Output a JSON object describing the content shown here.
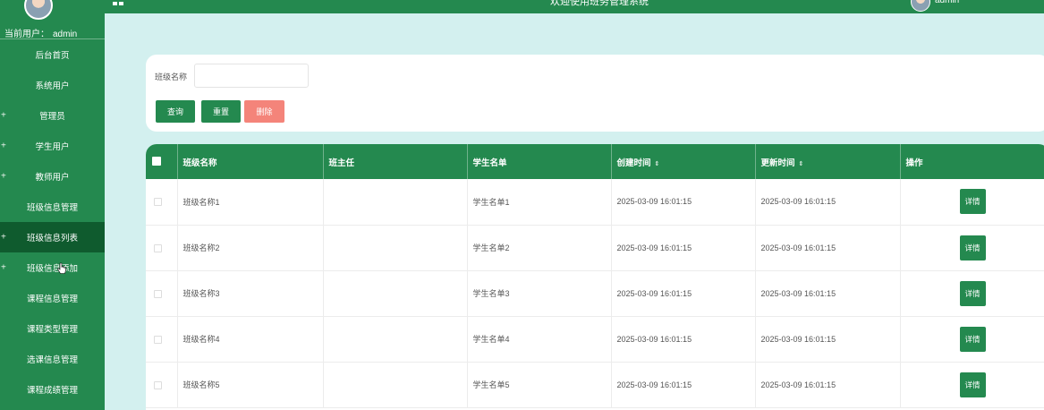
{
  "sidebar": {
    "current_user_label": "当前用户：",
    "current_user_name": "admin",
    "items": [
      {
        "label": "后台首页",
        "expandable": false
      },
      {
        "label": "系统用户",
        "expandable": false
      },
      {
        "label": "管理员",
        "expandable": true
      },
      {
        "label": "学生用户",
        "expandable": true
      },
      {
        "label": "教师用户",
        "expandable": true
      },
      {
        "label": "班级信息管理",
        "expandable": false
      },
      {
        "label": "班级信息列表",
        "expandable": true,
        "active": true
      },
      {
        "label": "班级信息添加",
        "expandable": true
      },
      {
        "label": "课程信息管理",
        "expandable": false
      },
      {
        "label": "课程类型管理",
        "expandable": false
      },
      {
        "label": "选课信息管理",
        "expandable": false
      },
      {
        "label": "课程成绩管理",
        "expandable": false
      }
    ],
    "plus_symbol": "+"
  },
  "header": {
    "title": "欢迎使用班务管理系统",
    "user_name": "admin"
  },
  "search": {
    "label": "班级名称",
    "value": "",
    "placeholder": "",
    "query_label": "查询",
    "reset_label": "重置",
    "delete_label": "删除"
  },
  "table": {
    "columns": [
      "班级名称",
      "班主任",
      "学生名单",
      "创建时间",
      "更新时间",
      "操作"
    ],
    "sort_symbol": "⇕",
    "detail_label": "详情",
    "rows": [
      {
        "name": "班级名称1",
        "teacher": "",
        "students": "学生名单1",
        "created": "2025-03-09 16:01:15",
        "updated": "2025-03-09 16:01:15"
      },
      {
        "name": "班级名称2",
        "teacher": "",
        "students": "学生名单2",
        "created": "2025-03-09 16:01:15",
        "updated": "2025-03-09 16:01:15"
      },
      {
        "name": "班级名称3",
        "teacher": "",
        "students": "学生名单3",
        "created": "2025-03-09 16:01:15",
        "updated": "2025-03-09 16:01:15"
      },
      {
        "name": "班级名称4",
        "teacher": "",
        "students": "学生名单4",
        "created": "2025-03-09 16:01:15",
        "updated": "2025-03-09 16:01:15"
      },
      {
        "name": "班级名称5",
        "teacher": "",
        "students": "学生名单5",
        "created": "2025-03-09 16:01:15",
        "updated": "2025-03-09 16:01:15"
      }
    ]
  },
  "colors": {
    "primary": "#24894f",
    "sidebar_active": "#0f5b2e",
    "danger": "#f4847a",
    "page_bg": "#d3f0ef"
  }
}
